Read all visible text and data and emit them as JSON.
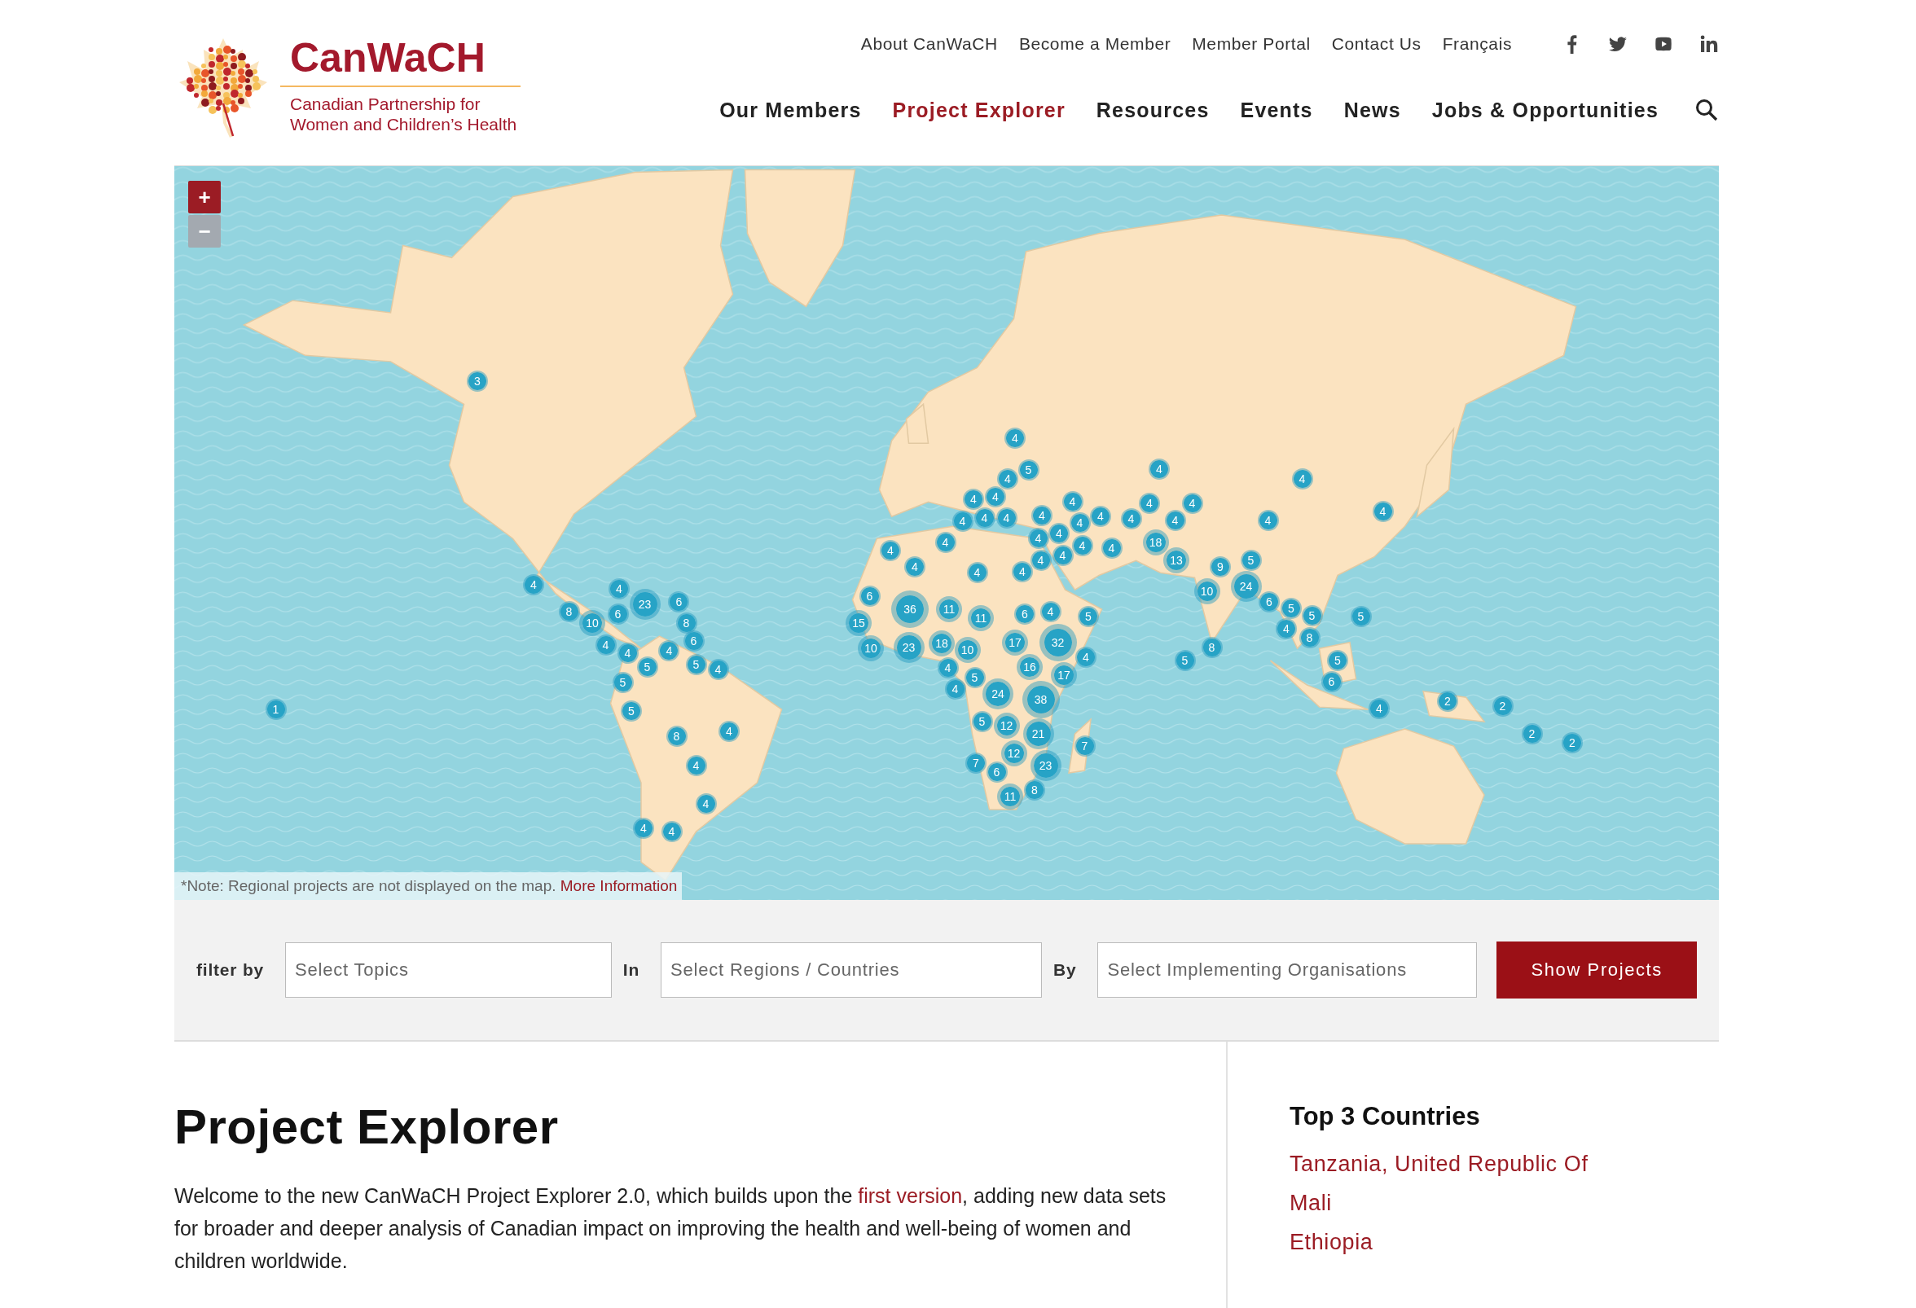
{
  "header": {
    "logo": {
      "name": "CanWaCH",
      "tagline_lines": [
        "Canadian Partnership for",
        "Women and Children’s Health"
      ]
    },
    "top_links": [
      "About CanWaCH",
      "Become a Member",
      "Member Portal",
      "Contact Us",
      "Français"
    ],
    "nav": [
      {
        "label": "Our Members",
        "selected": false
      },
      {
        "label": "Project Explorer",
        "selected": true
      },
      {
        "label": "Resources",
        "selected": false
      },
      {
        "label": "Events",
        "selected": false
      },
      {
        "label": "News",
        "selected": false
      },
      {
        "label": "Jobs & Opportunities",
        "selected": false
      }
    ]
  },
  "map": {
    "zoom_controls": [
      {
        "label": "+",
        "disabled": false
      },
      {
        "label": "−",
        "disabled": true
      }
    ],
    "markers": [
      {
        "label": "3"
      },
      {
        "label": "1"
      },
      {
        "label": "4"
      },
      {
        "label": "4"
      },
      {
        "label": "6"
      },
      {
        "label": "23"
      },
      {
        "label": "8"
      },
      {
        "label": "10"
      },
      {
        "label": "4"
      },
      {
        "label": "4"
      },
      {
        "label": "6"
      },
      {
        "label": "8"
      },
      {
        "label": "6"
      },
      {
        "label": "5"
      },
      {
        "label": "4"
      },
      {
        "label": "5"
      },
      {
        "label": "4"
      },
      {
        "label": "5"
      },
      {
        "label": "5"
      },
      {
        "label": "8"
      },
      {
        "label": "4"
      },
      {
        "label": "4"
      },
      {
        "label": "4"
      },
      {
        "label": "4"
      },
      {
        "label": "4"
      },
      {
        "label": "4"
      },
      {
        "label": "5"
      },
      {
        "label": "4"
      },
      {
        "label": "4"
      },
      {
        "label": "4"
      },
      {
        "label": "4"
      },
      {
        "label": "4"
      },
      {
        "label": "4"
      },
      {
        "label": "4"
      },
      {
        "label": "4"
      },
      {
        "label": "4"
      },
      {
        "label": "4"
      },
      {
        "label": "4"
      },
      {
        "label": "4"
      },
      {
        "label": "4"
      },
      {
        "label": "4"
      },
      {
        "label": "4"
      },
      {
        "label": "4"
      },
      {
        "label": "4"
      },
      {
        "label": "4"
      },
      {
        "label": "4"
      },
      {
        "label": "4"
      },
      {
        "label": "4"
      },
      {
        "label": "18"
      },
      {
        "label": "13"
      },
      {
        "label": "4"
      },
      {
        "label": "4"
      },
      {
        "label": "4"
      },
      {
        "label": "4"
      },
      {
        "label": "4"
      },
      {
        "label": "6"
      },
      {
        "label": "36"
      },
      {
        "label": "11"
      },
      {
        "label": "11"
      },
      {
        "label": "6"
      },
      {
        "label": "4"
      },
      {
        "label": "5"
      },
      {
        "label": "15"
      },
      {
        "label": "10"
      },
      {
        "label": "23"
      },
      {
        "label": "18"
      },
      {
        "label": "10"
      },
      {
        "label": "17"
      },
      {
        "label": "32"
      },
      {
        "label": "4"
      },
      {
        "label": "4"
      },
      {
        "label": "4"
      },
      {
        "label": "5"
      },
      {
        "label": "24"
      },
      {
        "label": "16"
      },
      {
        "label": "17"
      },
      {
        "label": "38"
      },
      {
        "label": "5"
      },
      {
        "label": "12"
      },
      {
        "label": "21"
      },
      {
        "label": "12"
      },
      {
        "label": "23"
      },
      {
        "label": "7"
      },
      {
        "label": "7"
      },
      {
        "label": "6"
      },
      {
        "label": "8"
      },
      {
        "label": "11"
      },
      {
        "label": "4"
      },
      {
        "label": "4"
      },
      {
        "label": "4"
      },
      {
        "label": "9"
      },
      {
        "label": "5"
      },
      {
        "label": "24"
      },
      {
        "label": "10"
      },
      {
        "label": "6"
      },
      {
        "label": "5"
      },
      {
        "label": "5"
      },
      {
        "label": "4"
      },
      {
        "label": "8"
      },
      {
        "label": "5"
      },
      {
        "label": "8"
      },
      {
        "label": "5"
      },
      {
        "label": "5"
      },
      {
        "label": "6"
      },
      {
        "label": "4"
      },
      {
        "label": "2"
      },
      {
        "label": "2"
      },
      {
        "label": "2"
      },
      {
        "label": "2"
      }
    ],
    "note": {
      "text": "*Note: Regional projects are not displayed on the map.",
      "link": "More Information"
    }
  },
  "filter": {
    "items": [
      {
        "kind": "label",
        "text": "filter by"
      },
      {
        "kind": "field",
        "placeholder": "Select Topics"
      },
      {
        "kind": "label",
        "text": "In"
      },
      {
        "kind": "field",
        "placeholder": "Select Regions / Countries"
      },
      {
        "kind": "label",
        "text": "By"
      },
      {
        "kind": "field",
        "placeholder": "Select Implementing Organisations"
      },
      {
        "kind": "button",
        "text": "Show Projects"
      }
    ]
  },
  "intro": {
    "title": "Project Explorer",
    "paragraph_before": "Welcome to the new CanWaCH Project Explorer 2.0, which builds upon the ",
    "paragraph_link": "first version",
    "paragraph_after": ", adding new data sets for broader and deeper analysis of Canadian impact on improving the health and well-being of women and children worldwide."
  },
  "top_countries": {
    "title": "Top 3 Countries",
    "items": [
      "Tanzania, United Republic Of",
      "Mali",
      "Ethiopia"
    ]
  }
}
